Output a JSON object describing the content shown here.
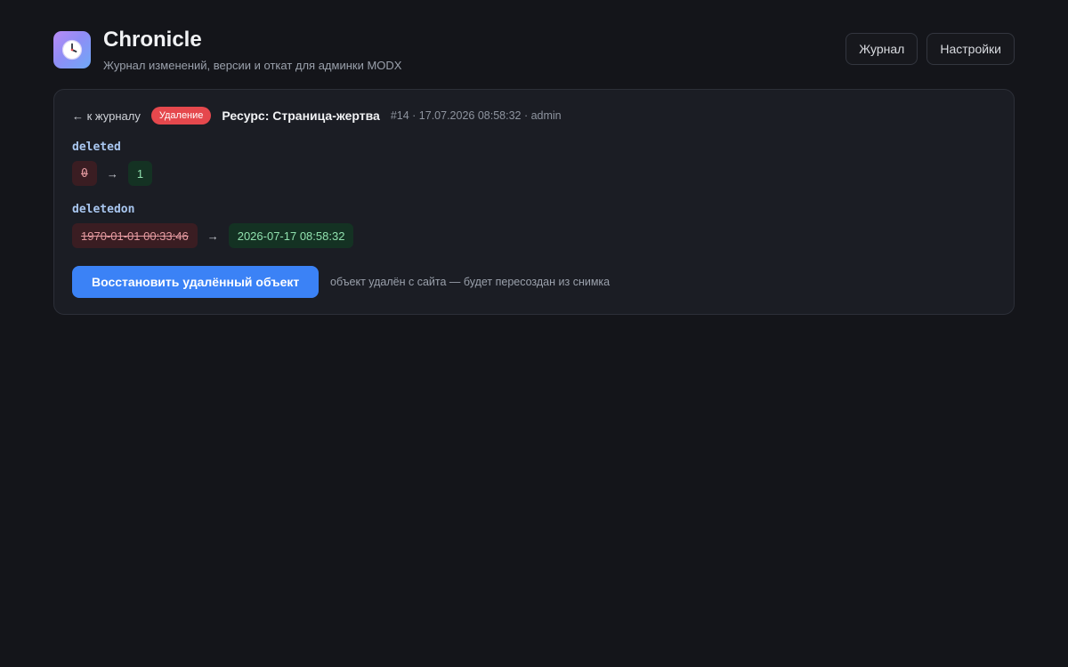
{
  "app": {
    "title": "Chronicle",
    "subtitle": "Журнал изменений, версии и откат для админки MODX",
    "logo_icon": "clock-icon"
  },
  "nav": {
    "journal_label": "Журнал",
    "settings_label": "Настройки"
  },
  "entry": {
    "back_arrow": "←",
    "back_label": "к журналу",
    "badge": "Удаление",
    "title": "Ресурс: Страница-жертва",
    "meta": "#14 · 17.07.2026 08:58:32 · admin",
    "changes": [
      {
        "field": "deleted",
        "old": "0",
        "new": "1"
      },
      {
        "field": "deletedon",
        "old": "1970-01-01 00:33:46",
        "new": "2026-07-17 08:58:32"
      }
    ],
    "arrow": "→",
    "restore_label": "Восстановить удалённый объект",
    "restore_note": "объект удалён с сайта — будет пересоздан из снимка"
  },
  "colors": {
    "accent": "#3b82f6",
    "danger": "#e5484d",
    "old_value_bg": "#3a1d22",
    "new_value_bg": "#143223"
  }
}
